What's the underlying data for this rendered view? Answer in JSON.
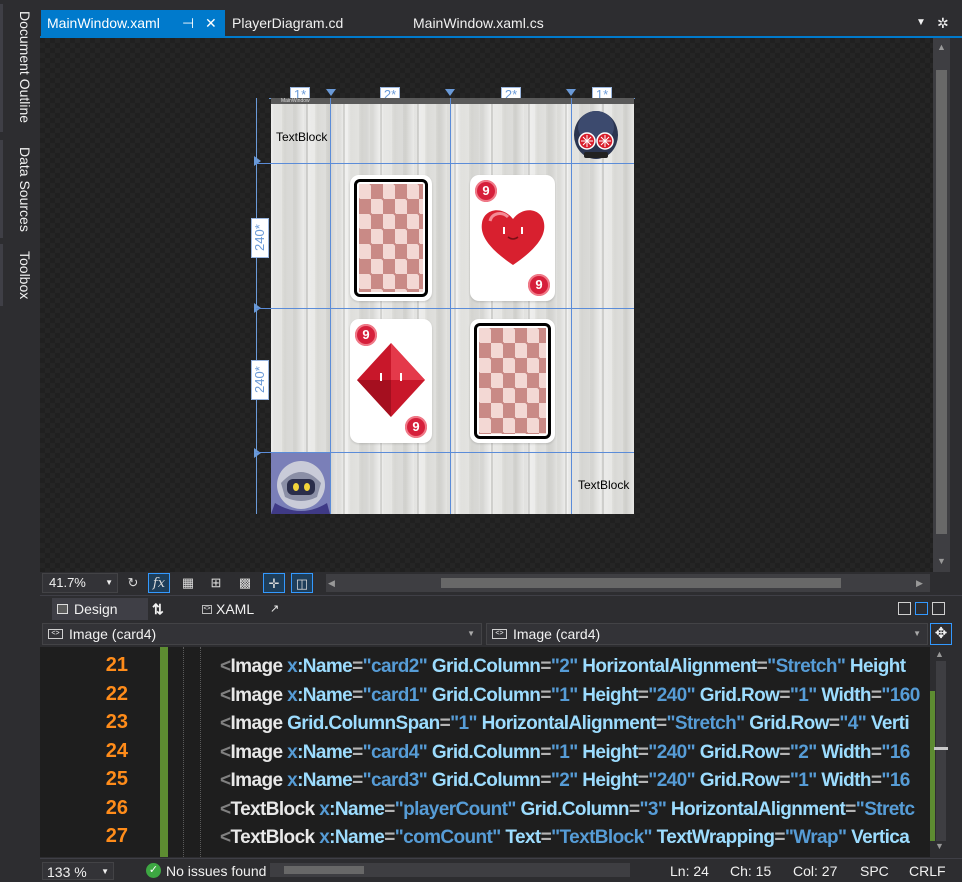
{
  "side_tabs": [
    "Document Outline",
    "Data Sources",
    "Toolbox"
  ],
  "tabs": [
    {
      "label": "MainWindow.xaml",
      "active": true,
      "pin_icon": "pin-icon",
      "close_icon": "close-icon"
    },
    {
      "label": "PlayerDiagram.cd",
      "active": false
    },
    {
      "label": "MainWindow.xaml.cs",
      "active": false
    }
  ],
  "colors": {
    "accent": "#007acc",
    "editor_bg": "#1e1e1e",
    "line_number": "#ff8c1a",
    "change_bar": "#5d8c31",
    "grid_line": "#5b8cd8"
  },
  "designer": {
    "window_title": "MainWindow",
    "column_sizes": [
      "1*",
      "2*",
      "2*",
      "1*"
    ],
    "row_sizes": [
      "240*",
      "240*"
    ],
    "textblock_top": "TextBlock",
    "textblock_bottom": "TextBlock",
    "cards": [
      {
        "name": "card-back",
        "pip": ""
      },
      {
        "name": "heart-nine",
        "pip": "9"
      },
      {
        "name": "diamond-nine",
        "pip": "9"
      },
      {
        "name": "card-back",
        "pip": ""
      }
    ]
  },
  "design_toolbar": {
    "zoom": "41.7%",
    "icons": [
      "refresh-icon",
      "fx-icon",
      "grid-icon",
      "snap-grid-icon",
      "checker-icon",
      "snap-lines-icon",
      "device-icon"
    ]
  },
  "split": {
    "design_label": "Design",
    "swap_label": "⇅",
    "xaml_label": "XAML"
  },
  "nav": {
    "left": "Image (card4)",
    "right": "Image (card4)"
  },
  "code": {
    "line_numbers": [
      "21",
      "22",
      "23",
      "24",
      "25",
      "26",
      "27"
    ],
    "lines": [
      [
        [
          "br",
          "<"
        ],
        [
          "el",
          "Image "
        ],
        [
          "ns",
          "x"
        ],
        [
          "at",
          ":Name"
        ],
        [
          "eq",
          "="
        ],
        [
          "v",
          "\"card2\""
        ],
        [
          "at",
          " Grid.Column"
        ],
        [
          "eq",
          "="
        ],
        [
          "v",
          "\"2\""
        ],
        [
          "at",
          " HorizontalAlignment"
        ],
        [
          "eq",
          "="
        ],
        [
          "v",
          "\"Stretch\""
        ],
        [
          "at",
          " Height"
        ]
      ],
      [
        [
          "br",
          "<"
        ],
        [
          "el",
          "Image "
        ],
        [
          "ns",
          "x"
        ],
        [
          "at",
          ":Name"
        ],
        [
          "eq",
          "="
        ],
        [
          "v",
          "\"card1\""
        ],
        [
          "at",
          " Grid.Column"
        ],
        [
          "eq",
          "="
        ],
        [
          "v",
          "\"1\""
        ],
        [
          "at",
          " Height"
        ],
        [
          "eq",
          "="
        ],
        [
          "v",
          "\"240\""
        ],
        [
          "at",
          " Grid.Row"
        ],
        [
          "eq",
          "="
        ],
        [
          "v",
          "\"1\""
        ],
        [
          "at",
          " Width"
        ],
        [
          "eq",
          "="
        ],
        [
          "v",
          "\"160"
        ]
      ],
      [
        [
          "br",
          "<"
        ],
        [
          "el",
          "Image "
        ],
        [
          "at",
          "Grid.ColumnSpan"
        ],
        [
          "eq",
          "="
        ],
        [
          "v",
          "\"1\""
        ],
        [
          "at",
          " HorizontalAlignment"
        ],
        [
          "eq",
          "="
        ],
        [
          "v",
          "\"Stretch\""
        ],
        [
          "at",
          " Grid.Row"
        ],
        [
          "eq",
          "="
        ],
        [
          "v",
          "\"4\""
        ],
        [
          "at",
          " Verti"
        ]
      ],
      [
        [
          "br",
          "<"
        ],
        [
          "el",
          "Image "
        ],
        [
          "ns",
          "x"
        ],
        [
          "at",
          ":Name"
        ],
        [
          "eq",
          "="
        ],
        [
          "v",
          "\"card4\""
        ],
        [
          "at",
          " Grid.Column"
        ],
        [
          "eq",
          "="
        ],
        [
          "v",
          "\"1\""
        ],
        [
          "at",
          " Height"
        ],
        [
          "eq",
          "="
        ],
        [
          "v",
          "\"240\""
        ],
        [
          "at",
          " Grid.Row"
        ],
        [
          "eq",
          "="
        ],
        [
          "v",
          "\"2\""
        ],
        [
          "at",
          " Width"
        ],
        [
          "eq",
          "="
        ],
        [
          "v",
          "\"16"
        ]
      ],
      [
        [
          "br",
          "<"
        ],
        [
          "el",
          "Image "
        ],
        [
          "ns",
          "x"
        ],
        [
          "at",
          ":Name"
        ],
        [
          "eq",
          "="
        ],
        [
          "v",
          "\"card3\""
        ],
        [
          "at",
          " Grid.Column"
        ],
        [
          "eq",
          "="
        ],
        [
          "v",
          "\"2\""
        ],
        [
          "at",
          " Height"
        ],
        [
          "eq",
          "="
        ],
        [
          "v",
          "\"240\""
        ],
        [
          "at",
          " Grid.Row"
        ],
        [
          "eq",
          "="
        ],
        [
          "v",
          "\"1\""
        ],
        [
          "at",
          " Width"
        ],
        [
          "eq",
          "="
        ],
        [
          "v",
          "\"16"
        ]
      ],
      [
        [
          "br",
          "<"
        ],
        [
          "el",
          "TextBlock "
        ],
        [
          "ns",
          "x"
        ],
        [
          "at",
          ":Name"
        ],
        [
          "eq",
          "="
        ],
        [
          "v",
          "\"playerCount\""
        ],
        [
          "at",
          " Grid.Column"
        ],
        [
          "eq",
          "="
        ],
        [
          "v",
          "\"3\""
        ],
        [
          "at",
          " HorizontalAlignment"
        ],
        [
          "eq",
          "="
        ],
        [
          "v",
          "\"Stretc"
        ]
      ],
      [
        [
          "br",
          "<"
        ],
        [
          "el",
          "TextBlock "
        ],
        [
          "ns",
          "x"
        ],
        [
          "at",
          ":Name"
        ],
        [
          "eq",
          "="
        ],
        [
          "v",
          "\"comCount\""
        ],
        [
          "at",
          " Text"
        ],
        [
          "eq",
          "="
        ],
        [
          "v",
          "\"TextBlock\""
        ],
        [
          "at",
          " TextWrapping"
        ],
        [
          "eq",
          "="
        ],
        [
          "v",
          "\"Wrap\""
        ],
        [
          "at",
          " Vertica"
        ]
      ]
    ]
  },
  "status": {
    "zoom": "133 %",
    "issues": "No issues found",
    "ln": "Ln: 24",
    "ch": "Ch: 15",
    "col": "Col: 27",
    "spc": "SPC",
    "crlf": "CRLF"
  }
}
